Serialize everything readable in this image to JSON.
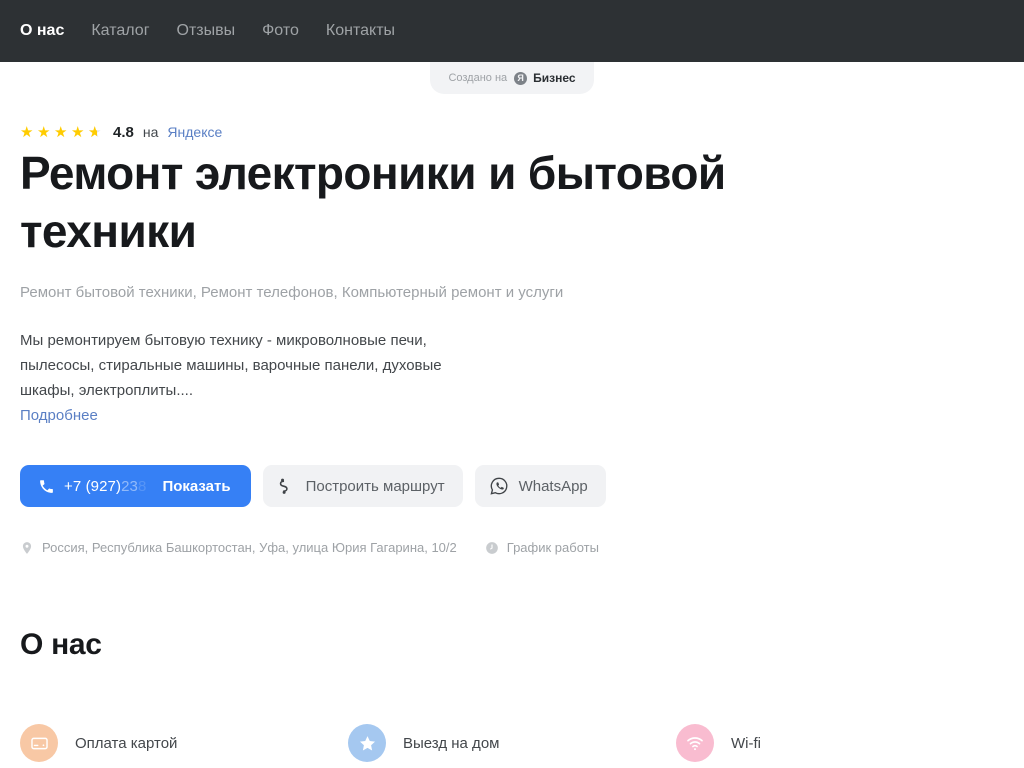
{
  "nav": {
    "items": [
      {
        "label": "О нас",
        "active": true
      },
      {
        "label": "Каталог",
        "active": false
      },
      {
        "label": "Отзывы",
        "active": false
      },
      {
        "label": "Фото",
        "active": false
      },
      {
        "label": "Контакты",
        "active": false
      }
    ]
  },
  "badge": {
    "prefix": "Создано на",
    "logo_letter": "Я",
    "brand": "Бизнес"
  },
  "rating": {
    "stars_filled": 4,
    "stars_half": 1,
    "stars_total": 5,
    "value": "4.8",
    "suffix": "на",
    "source": "Яндексе"
  },
  "hero": {
    "title": "Ремонт электроники и бытовой техники",
    "subtitle": "Ремонт бытовой техники, Ремонт телефонов, Компьютерный ремонт и услуги",
    "description": "Мы ремонтируем бытовую технику - микроволновые печи, пылесосы, стиральные машины, варочные панели, духовые шкафы, электроплиты....",
    "more_link": "Подробнее"
  },
  "actions": {
    "phone": {
      "visible_number": "+7 (927)",
      "masked_digits": "23",
      "faded_digits": "8",
      "show_label": "Показать",
      "icon": "phone-icon"
    },
    "route": {
      "label": "Построить маршрут",
      "icon": "route-icon"
    },
    "whatsapp": {
      "label": "WhatsApp",
      "icon": "whatsapp-icon"
    }
  },
  "meta": {
    "address": "Россия, Республика Башкортостан, Уфа, улица Юрия Гагарина, 10/2",
    "address_icon": "pin-icon",
    "schedule": "График работы",
    "schedule_icon": "clock-icon"
  },
  "about": {
    "title": "О нас",
    "features": [
      {
        "label": "Оплата картой",
        "icon": "credit-card-icon",
        "color": "#f8c8a5"
      },
      {
        "label": "Выезд на дом",
        "icon": "star-icon",
        "color": "#a5c8f0"
      },
      {
        "label": "Wi-fi",
        "icon": "wifi-icon",
        "color": "#f9bcd0"
      }
    ]
  },
  "colors": {
    "nav_bg": "#2d3134",
    "accent_blue": "#3680f5",
    "link_blue": "#5a7fc4",
    "star_gold": "#ffcc00",
    "grey_button": "#f1f2f4"
  }
}
